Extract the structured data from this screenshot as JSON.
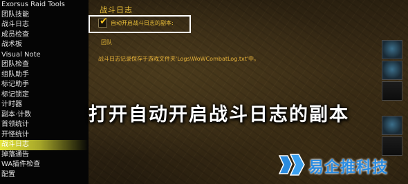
{
  "sidebar": {
    "items": [
      {
        "label": "Exorsus Raid Tools",
        "active": false
      },
      {
        "label": "团队技能",
        "active": false
      },
      {
        "label": "战斗日志",
        "active": false
      },
      {
        "label": "成员检查",
        "active": false
      },
      {
        "label": "战术板",
        "active": false
      },
      {
        "label": "Visual Note",
        "active": false
      },
      {
        "label": "团队检查",
        "active": false
      },
      {
        "label": "组队助手",
        "active": false
      },
      {
        "label": "标记助手",
        "active": false
      },
      {
        "label": "标记锁定",
        "active": false
      },
      {
        "label": "计时器",
        "active": false
      },
      {
        "label": "副本·计数",
        "active": false
      },
      {
        "label": "首领统计",
        "active": false
      },
      {
        "label": "开怪统计",
        "active": false
      },
      {
        "label": "战斗日志",
        "active": true
      },
      {
        "label": "掉落通告",
        "active": false
      },
      {
        "label": "WA插件检查",
        "active": false
      },
      {
        "label": "配置",
        "active": false
      }
    ]
  },
  "panel": {
    "title": "战斗日志",
    "checkbox_label": "自动开启战斗日志的副本:",
    "checkbox_checked": true,
    "option_label": "团队",
    "info_text": "战斗日志记录保存于游戏文件夹'Logs\\WoWCombatLog.txt'中。"
  },
  "overlay": {
    "caption": "打开自动开启战斗日志的副本"
  },
  "watermark": {
    "text": "易企推科技"
  },
  "colors": {
    "accent_gold": "#f0c43a",
    "active_item": "#e4e43a",
    "watermark_blue": "#2a8be0"
  }
}
